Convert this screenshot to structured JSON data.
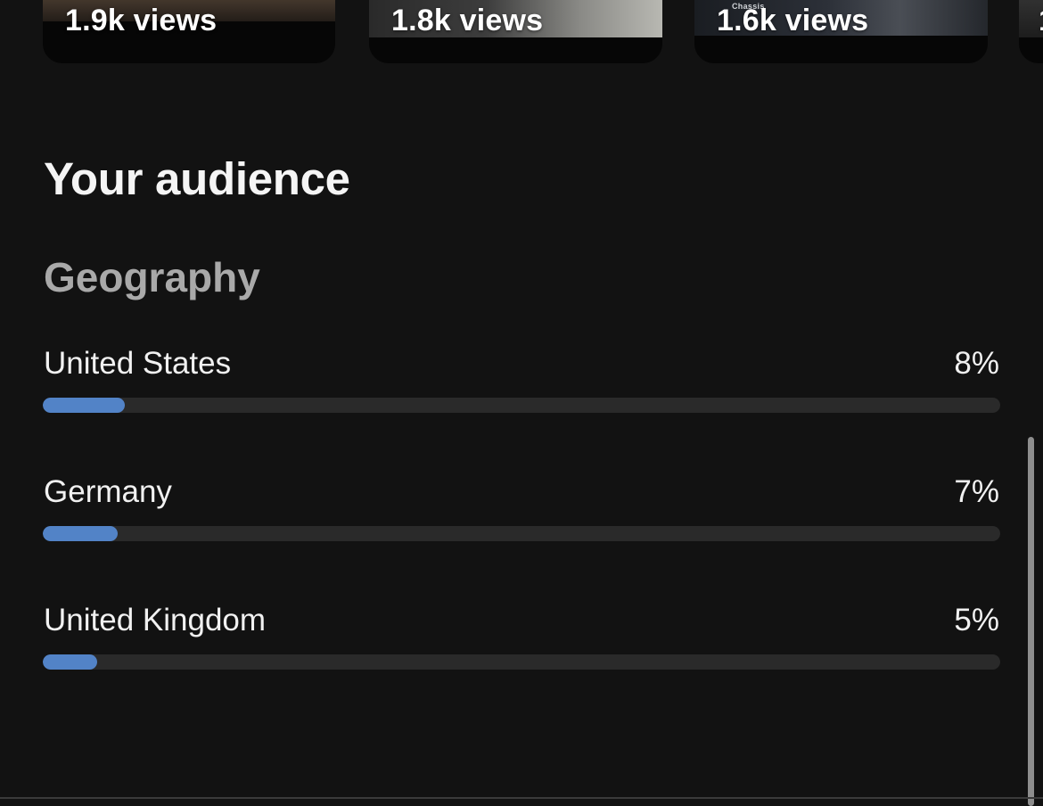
{
  "top_videos": [
    {
      "views": "1.9k views"
    },
    {
      "views": "1.8k views"
    },
    {
      "views": "1.6k views",
      "thumb_text": "Chassis"
    },
    {
      "views": "1"
    }
  ],
  "audience": {
    "title": "Your audience",
    "geography": {
      "heading": "Geography",
      "rows": [
        {
          "country": "United States",
          "percent_label": "8%",
          "value": 0.086
        },
        {
          "country": "Germany",
          "percent_label": "7%",
          "value": 0.078
        },
        {
          "country": "United Kingdom",
          "percent_label": "5%",
          "value": 0.057
        }
      ]
    }
  },
  "colors": {
    "bar_fill": "#5283c7",
    "bar_track": "#2a2a2a",
    "background": "#121212"
  }
}
